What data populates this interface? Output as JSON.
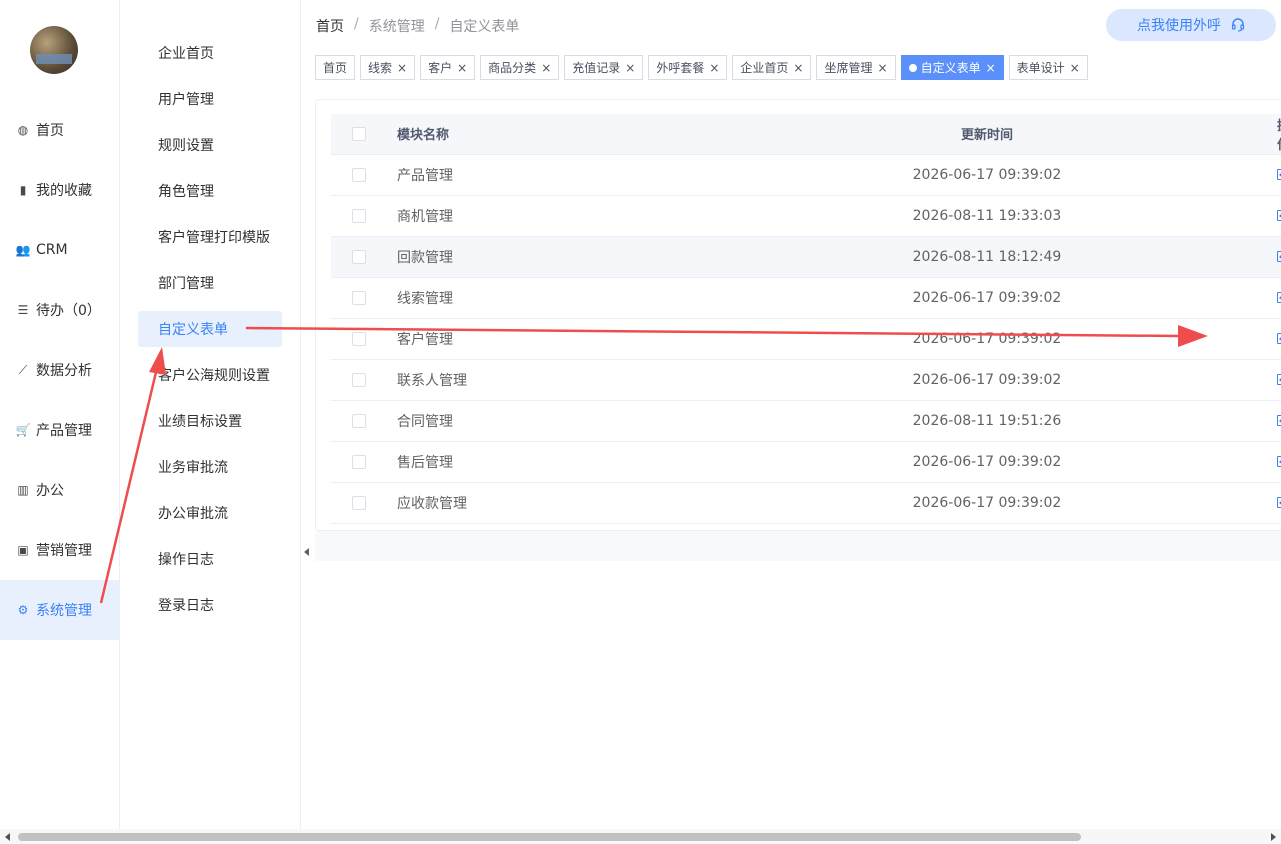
{
  "nav1": {
    "items": [
      {
        "label": "首页",
        "icon": "dashboard-icon"
      },
      {
        "label": "我的收藏",
        "icon": "bookmark-icon"
      },
      {
        "label": "CRM",
        "icon": "users-icon"
      },
      {
        "label": "待办（0）",
        "icon": "sliders-icon"
      },
      {
        "label": "数据分析",
        "icon": "chart-line-icon"
      },
      {
        "label": "产品管理",
        "icon": "cart-icon"
      },
      {
        "label": "办公",
        "icon": "book-icon"
      },
      {
        "label": "营销管理",
        "icon": "image-icon"
      },
      {
        "label": "系统管理",
        "icon": "gear-icon"
      }
    ],
    "active_index": 8
  },
  "nav2": {
    "items": [
      "企业首页",
      "用户管理",
      "规则设置",
      "角色管理",
      "客户管理打印模版",
      "部门管理",
      "自定义表单",
      "客户公海规则设置",
      "业绩目标设置",
      "业务审批流",
      "办公审批流",
      "操作日志",
      "登录日志"
    ],
    "active_index": 6
  },
  "breadcrumb": {
    "home": "首页",
    "sep": "/",
    "section": "系统管理",
    "page": "自定义表单"
  },
  "call_button": {
    "label": "点我使用外呼",
    "icon": "headset-icon"
  },
  "tags": [
    {
      "label": "首页",
      "closable": false
    },
    {
      "label": "线索",
      "closable": true
    },
    {
      "label": "客户",
      "closable": true
    },
    {
      "label": "商品分类",
      "closable": true
    },
    {
      "label": "充值记录",
      "closable": true
    },
    {
      "label": "外呼套餐",
      "closable": true
    },
    {
      "label": "企业首页",
      "closable": true
    },
    {
      "label": "坐席管理",
      "closable": true
    },
    {
      "label": "自定义表单",
      "closable": true,
      "active": true
    },
    {
      "label": "表单设计",
      "closable": true
    }
  ],
  "table": {
    "headers": {
      "name": "模块名称",
      "time": "更新时间",
      "op": "操作"
    },
    "edit_label": "修改",
    "rows": [
      {
        "name": "产品管理",
        "time": "2026-06-17 09:39:02"
      },
      {
        "name": "商机管理",
        "time": "2026-08-11 19:33:03"
      },
      {
        "name": "回款管理",
        "time": "2026-08-11 18:12:49"
      },
      {
        "name": "线索管理",
        "time": "2026-06-17 09:39:02"
      },
      {
        "name": "客户管理",
        "time": "2026-06-17 09:39:02"
      },
      {
        "name": "联系人管理",
        "time": "2026-06-17 09:39:02"
      },
      {
        "name": "合同管理",
        "time": "2026-08-11 19:51:26"
      },
      {
        "name": "售后管理",
        "time": "2026-06-17 09:39:02"
      },
      {
        "name": "应收款管理",
        "time": "2026-06-17 09:39:02"
      }
    ]
  },
  "colors": {
    "accent": "#3b82f6",
    "active_bg": "#e8f0fe",
    "annotation": "#ef4d4d"
  }
}
